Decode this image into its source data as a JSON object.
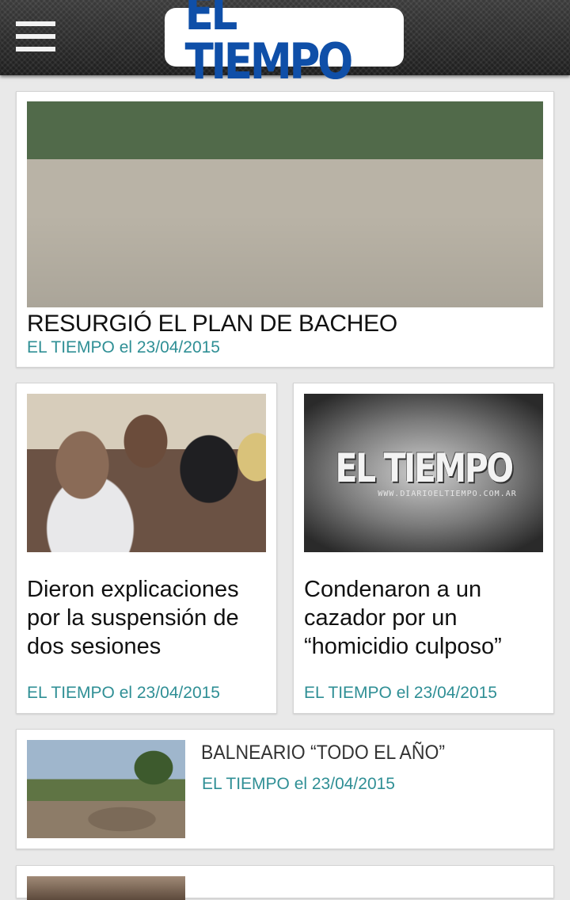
{
  "header": {
    "logo_text": "EL TIEMPO",
    "menu_icon": "hamburger-menu-icon"
  },
  "articles": [
    {
      "title": "RESURGIÓ EL PLAN DE BACHEO",
      "byline": "EL TIEMPO el 23/04/2015",
      "image": "street-repair-photo"
    },
    {
      "title": "Dieron explicaciones por la  suspensión de dos sesiones",
      "byline": "EL TIEMPO el 23/04/2015",
      "image": "meeting-photo"
    },
    {
      "title": "Condenaron a un cazador por un “homicidio culposo”",
      "byline": "EL TIEMPO el 23/04/2015",
      "image": "el-tiempo-logo-placeholder",
      "image_title": "EL TIEMPO",
      "image_url": "WWW.DIARIOELTIEMPO.COM.AR"
    },
    {
      "title": "BALNEARIO  “TODO EL AÑO”",
      "byline": "EL TIEMPO el 23/04/2015",
      "image": "park-photo"
    }
  ],
  "colors": {
    "header_bg": "#2a2a2a",
    "logo_blue": "#0f4fa8",
    "byline_teal": "#2f8f95",
    "page_bg": "#e9e9e9"
  }
}
